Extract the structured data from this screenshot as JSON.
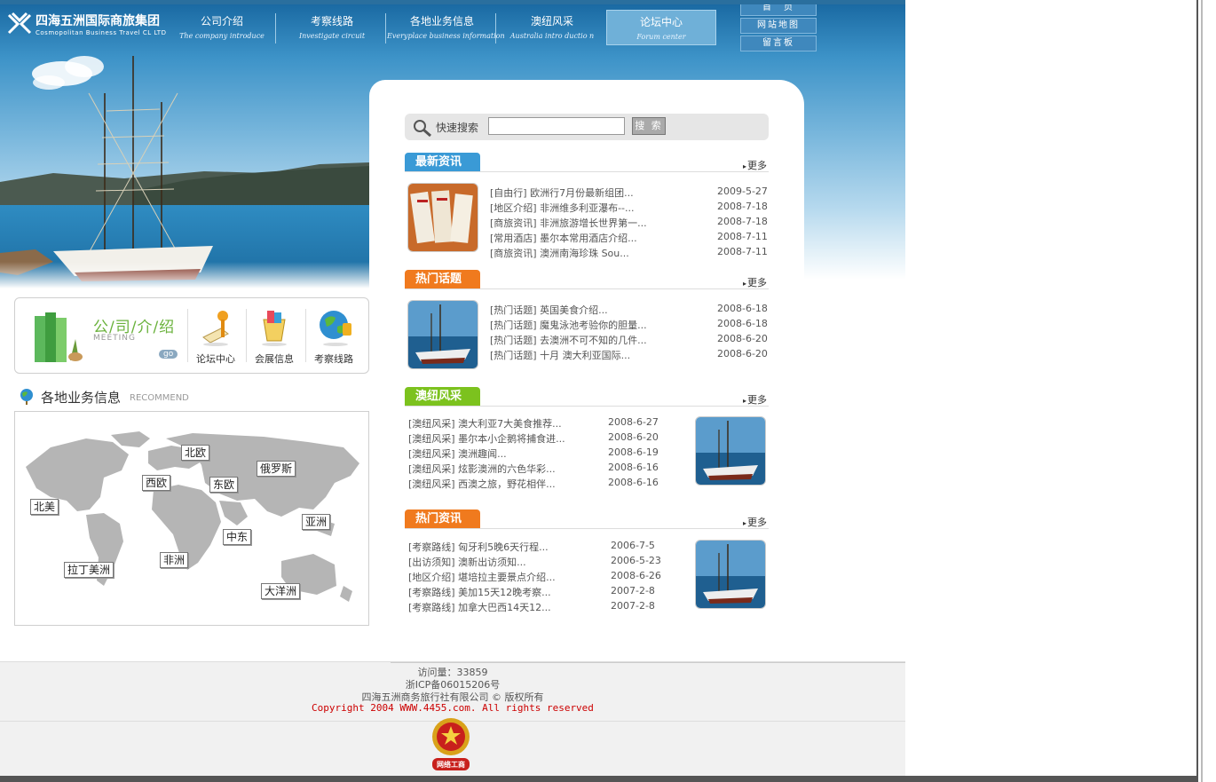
{
  "header": {
    "logo_cn": "四海五洲国际商旅集团",
    "logo_en": "Cosmopolitan Business Travel CL LTD",
    "nav": [
      {
        "cn": "公司介绍",
        "en": "The company introduce"
      },
      {
        "cn": "考察线路",
        "en": "Investigate circuit"
      },
      {
        "cn": "各地业务信息",
        "en": "Everyplace business information"
      },
      {
        "cn": "澳纽风采",
        "en": "Australia intro ductio n"
      },
      {
        "cn": "论坛中心",
        "en": "Forum center"
      }
    ],
    "quicklinks": [
      "首　页",
      "网站地图",
      "留言板"
    ]
  },
  "intro": {
    "title": "公/司/介/绍",
    "subtitle": "MEETING",
    "go": "go",
    "items": [
      "论坛中心",
      "会展信息",
      "考察线路"
    ]
  },
  "business": {
    "title": "各地业务信息",
    "subtitle": "RECOMMEND",
    "regions": [
      "北欧",
      "俄罗斯",
      "西欧",
      "东欧",
      "北美",
      "亚洲",
      "中东",
      "非洲",
      "拉丁美洲",
      "大洋洲"
    ]
  },
  "search": {
    "label": "快速搜索",
    "value": "",
    "button": "搜 索"
  },
  "sections": [
    {
      "title": "最新资讯",
      "color": "#3a9ad6",
      "more": "更多",
      "rows": [
        {
          "text": "[自由行] 欧洲行7月份最新组团...",
          "date": "2009-5-27"
        },
        {
          "text": "[地区介绍] 非洲维多利亚瀑布--...",
          "date": "2008-7-18"
        },
        {
          "text": "[商旅资讯] 非洲旅游增长世界第一...",
          "date": "2008-7-18"
        },
        {
          "text": "[常用酒店] 墨尔本常用酒店介绍...",
          "date": "2008-7-11"
        },
        {
          "text": "[商旅资讯] 澳洲南海珍珠 Sou...",
          "date": "2008-7-11"
        }
      ]
    },
    {
      "title": "热门话题",
      "color": "#f07a1e",
      "more": "更多",
      "rows": [
        {
          "text": "[热门话题] 英国美食介绍...",
          "date": "2008-6-18"
        },
        {
          "text": "[热门话题] 魔鬼泳池考验你的胆量...",
          "date": "2008-6-18"
        },
        {
          "text": "[热门话题] 去澳洲不可不知的几件...",
          "date": "2008-6-20"
        },
        {
          "text": "[热门话题] 十月 澳大利亚国际...",
          "date": "2008-6-20"
        }
      ]
    },
    {
      "title": "澳纽风采",
      "color": "#7cc21e",
      "more": "更多",
      "rows": [
        {
          "text": "[澳纽风采] 澳大利亚7大美食推荐...",
          "date": "2008-6-27"
        },
        {
          "text": "[澳纽风采] 墨尔本小企鹅将捕食进...",
          "date": "2008-6-20"
        },
        {
          "text": "[澳纽风采] 澳洲趣闻...",
          "date": "2008-6-19"
        },
        {
          "text": "[澳纽风采] 炫影澳洲的六色华彩...",
          "date": "2008-6-16"
        },
        {
          "text": "[澳纽风采] 西澳之旅，野花相伴...",
          "date": "2008-6-16"
        }
      ]
    },
    {
      "title": "热门资讯",
      "color": "#f07a1e",
      "more": "更多",
      "rows": [
        {
          "text": "[考察路线] 匈牙利5晚6天行程...",
          "date": "2006-7-5"
        },
        {
          "text": "[出访须知] 澳新出访须知...",
          "date": "2006-5-23"
        },
        {
          "text": "[地区介绍] 堪培拉主要景点介绍...",
          "date": "2008-6-26"
        },
        {
          "text": "[考察路线] 美加15天12晚考察...",
          "date": "2007-2-8"
        },
        {
          "text": "[考察路线] 加拿大巴西14天12...",
          "date": "2007-2-8"
        }
      ]
    }
  ],
  "footer": {
    "visits": "访问量：33859",
    "icp": "浙ICP备06015206号",
    "company": "四海五洲商务旅行社有限公司 © 版权所有",
    "copyright": "Copyright 2004 WWW.4455.com. All rights reserved",
    "badge": "网络工商"
  }
}
